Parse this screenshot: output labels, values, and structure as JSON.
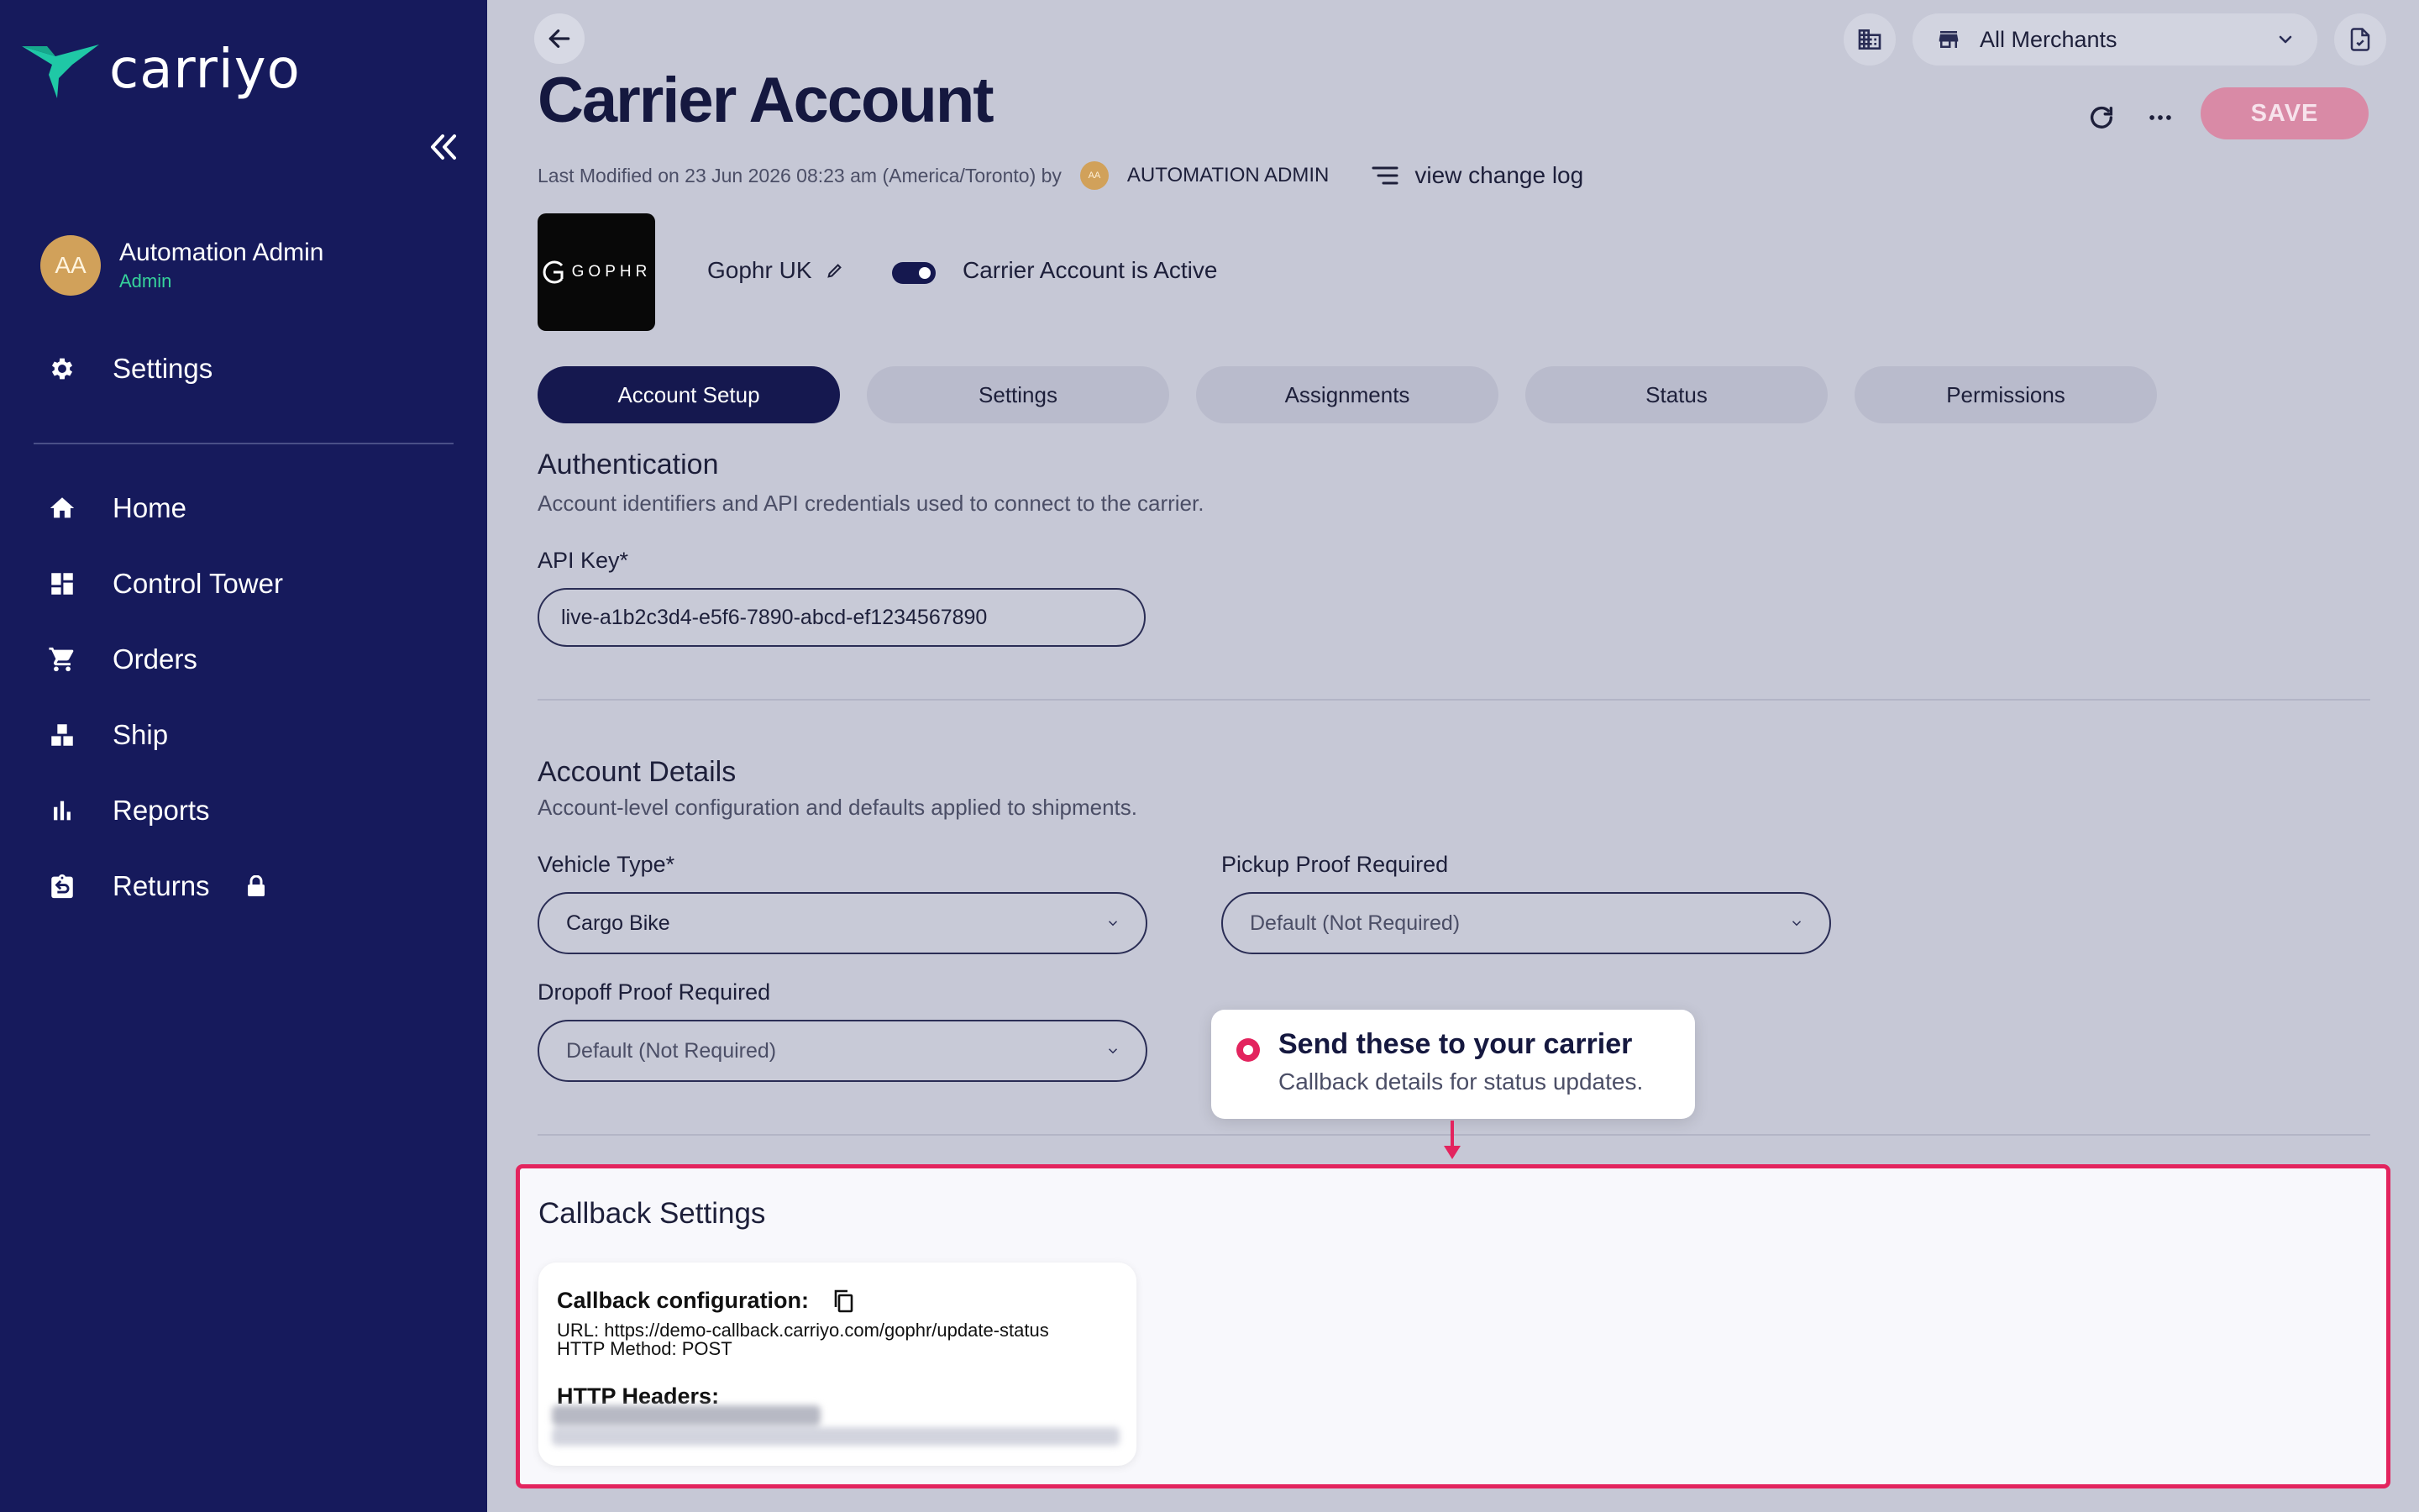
{
  "brand": {
    "name": "carriyo",
    "accent": "#1fc8a6",
    "sidebar_bg": "#161a5c",
    "highlight": "#e3245e"
  },
  "user": {
    "initials": "AA",
    "name": "Automation Admin",
    "role": "Admin"
  },
  "sidebar": {
    "settings_label": "Settings",
    "items": [
      {
        "label": "Home",
        "icon": "home-icon"
      },
      {
        "label": "Control Tower",
        "icon": "dashboard-icon"
      },
      {
        "label": "Orders",
        "icon": "cart-icon"
      },
      {
        "label": "Ship",
        "icon": "ship-icon"
      },
      {
        "label": "Reports",
        "icon": "bar-chart-icon"
      },
      {
        "label": "Returns",
        "icon": "returns-icon"
      }
    ]
  },
  "header": {
    "merchant_selector": "All Merchants",
    "page_title": "Carrier Account",
    "save_label": "SAVE",
    "meta_text": "Last Modified on 23 Jun 2026 08:23 am (America/Toronto) by",
    "meta_initials": "AA",
    "meta_user": "AUTOMATION ADMIN",
    "changelog_label": "view change log"
  },
  "carrier": {
    "logo_text": "GOPHR",
    "name": "Gophr UK",
    "active_label": "Carrier Account is Active",
    "active": true
  },
  "tabs": [
    {
      "label": "Account Setup",
      "active": true
    },
    {
      "label": "Settings",
      "active": false
    },
    {
      "label": "Assignments",
      "active": false
    },
    {
      "label": "Status",
      "active": false
    },
    {
      "label": "Permissions",
      "active": false
    }
  ],
  "authentication": {
    "title": "Authentication",
    "subtitle": "Account identifiers and API credentials used to connect to the carrier.",
    "api_key_label": "API Key*",
    "api_key_value": "live-a1b2c3d4-e5f6-7890-abcd-ef1234567890"
  },
  "account_details": {
    "title": "Account Details",
    "subtitle": "Account-level configuration and defaults applied to shipments.",
    "vehicle_label": "Vehicle Type*",
    "vehicle_value": "Cargo Bike",
    "pickup_label": "Pickup Proof Required",
    "pickup_value": "Default (Not Required)",
    "dropoff_label": "Dropoff Proof Required",
    "dropoff_value": "Default (Not Required)"
  },
  "tooltip": {
    "title": "Send these to your carrier",
    "subtitle": "Callback details for status updates."
  },
  "callback": {
    "title": "Callback Settings",
    "config_label": "Callback configuration:",
    "url_line": "URL: https://demo-callback.carriyo.com/gophr/update-status",
    "method_line": "HTTP Method: POST",
    "headers_label": "HTTP Headers:"
  }
}
